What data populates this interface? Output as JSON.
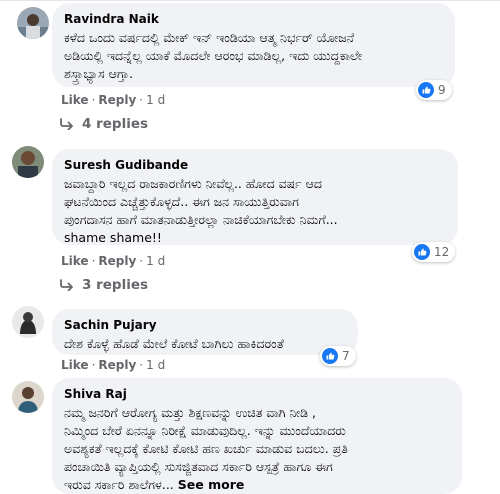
{
  "comments": [
    {
      "author": "Ravindra Naik",
      "text": "ಕಳೆದ ಒಂದು ವರ್ಷದಲ್ಲಿ ಮೇಕ್ ಇನ್ ಇಂಡಿಯಾ ಆತ್ಮ ನಿರ್ಭರ್ ಯೋಜನೆ\nಅಡಿಯಲ್ಲಿ ಇದನ್ನೆಲ್ಲ ಯಾಕೆ ಮೊದಲೇ ಆರಂಭ ಮಾಡಿಲ್ಲ, ಇದು ಯುದ್ದಕಾಲೇ\nಶಸ್ತ್ರಾಭ್ಯಾಸ ಆಗ್ತಾ.",
      "like_label": "Like",
      "reply_label": "Reply",
      "time": "1 d",
      "reactions": "9",
      "replies_label": "4 replies"
    },
    {
      "author": "Suresh Gudibande",
      "text": "ಜವಾಬ್ದಾರಿ ಇಲ್ಲದ ರಾಜಕಾರಣಿಗಳು ನೀವೆಲ್ಲ.. ಹೋದ ವರ್ಷ ಆದ\nಘಟನೆಯಿಂದ ಎಚ್ಚೆತ್ತುಕೊಳ್ಳದೆ.. ಈಗ ಜನ ಸಾಯುತ್ತಿರುವಾಗ\nಪುಂಗದಾಸನ ಹಾಗೆ ಮಾತನಾಡುತ್ತೀರಲ್ಲಾ ನಾಚಿಕೆಯಾಗಬೇಕು ನಿಮಗೆ...\nshame shame!!",
      "like_label": "Like",
      "reply_label": "Reply",
      "time": "1 d",
      "reactions": "12",
      "replies_label": "3 replies"
    },
    {
      "author": "Sachin Pujary",
      "text": "ದೇಶ ಕೊಳ್ಳೆ ಹೊಡೆ ಮೇಲೆ ಕೋಟೆ ಬಾಗಿಲು ಹಾಕಿದರಂತೆ",
      "like_label": "Like",
      "reply_label": "Reply",
      "time": "1 d",
      "reactions": "7"
    },
    {
      "author": "Shiva Raj",
      "text": "ನಮ್ಮ ಜನರಿಗೆ ಆರೋಗ್ಯ ಮತ್ತು ಶಿಕ್ಷಣವನ್ನು ಉಚಿತ ವಾಗಿ ನೀಡಿ ,\nನಿಮ್ಮಿಂದ ಬೇರೆ ಏನನ್ನೂ ನಿರೀಕ್ಷೆ ಮಾಡುವುದಿಲ್ಲ. ಇನ್ನು ಮುಂದೆಯಾದರು\nಅವಶ್ಯಕತೆ ಇಲ್ಲದಕ್ಕೆ ಕೋಟಿ ಕೋಟಿ ಹಣ ಖರ್ಚು ಮಾಡುವ ಬದಲು. ಪ್ರತಿ\nಪಂಚಾಯಿತಿ ವ್ಯಾಪ್ತಿಯಲ್ಲಿ ಸುಸಜ್ಜಿತವಾದ ಸರ್ಕಾರಿ ಆಸ್ಪತ್ರೆ ಹಾಗೂ ಈಗ\nಇರುವ ಸರ್ಕಾರಿ ಶಾಲೆಗಳ...",
      "see_more": "See more"
    }
  ],
  "colors": {
    "bubble": "#f0f2f5",
    "meta": "#65676b",
    "like_blue": "#1877f2"
  }
}
